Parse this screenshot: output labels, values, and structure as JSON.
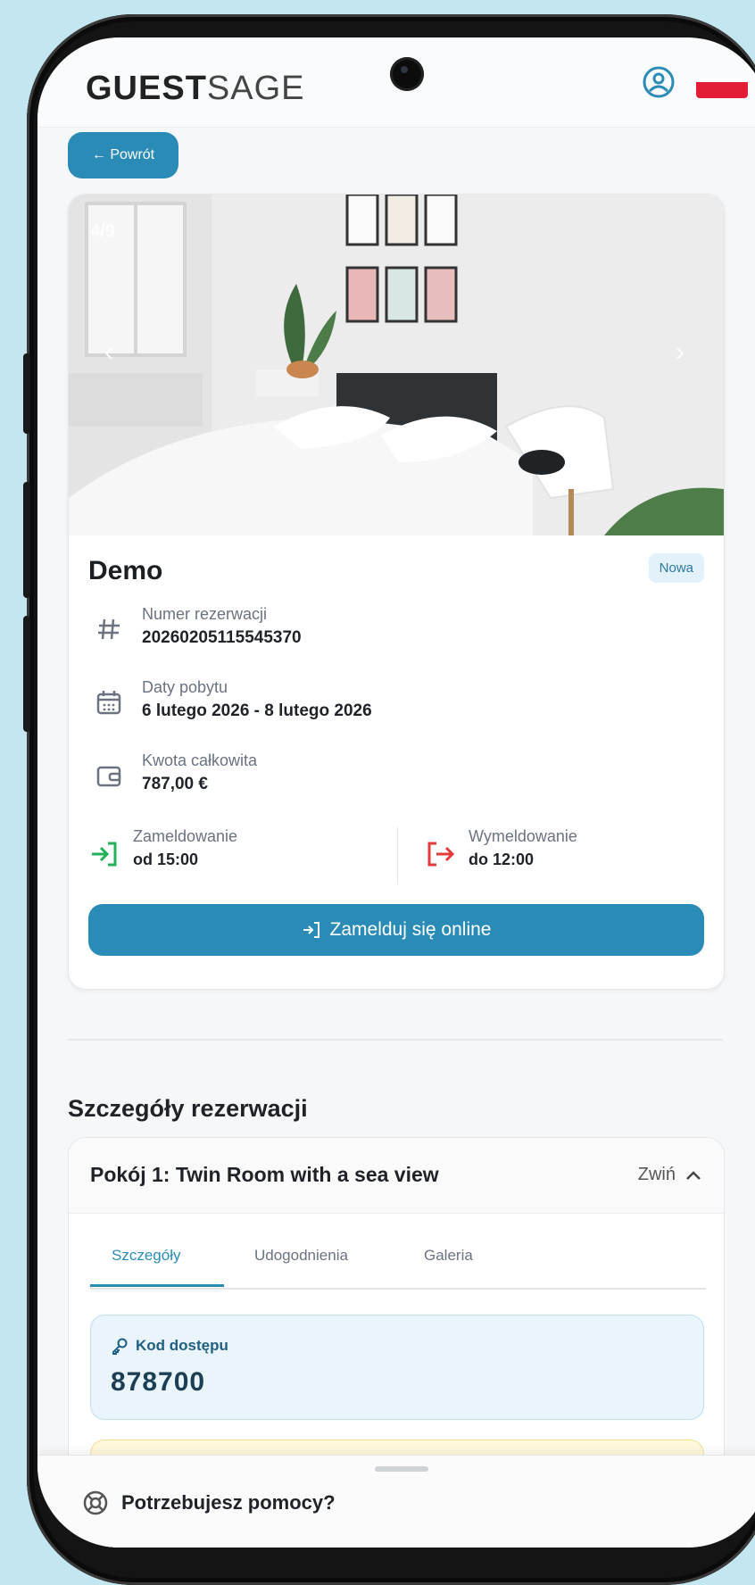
{
  "header": {
    "logo_bold": "GUEST",
    "logo_thin": "SAGE",
    "flag": "polish-flag"
  },
  "back_label": "← Powrót",
  "reservation": {
    "photo_counter": "4/9",
    "hotel_name": "Demo",
    "status": "Nowa",
    "number_label": "Numer rezerwacji",
    "number_value": "20260205115545370",
    "dates_label": "Daty pobytu",
    "dates_value": "6 lutego 2026 - 8 lutego 2026",
    "amount_label": "Kwota całkowita",
    "amount_value": "787,00 €",
    "checkin_label": "Zameldowanie",
    "checkin_value": "od 15:00",
    "checkout_label": "Wymeldowanie",
    "checkout_value": "do 12:00",
    "online_checkin_label": "Zamelduj się online"
  },
  "details": {
    "section_title": "Szczegóły rezerwacji",
    "room_title": "Pokój 1: Twin Room with a sea view",
    "collapse_label": "Zwiń",
    "tabs": [
      {
        "label": "Szczegóły",
        "active": true
      },
      {
        "label": "Udogodnienia",
        "active": false
      },
      {
        "label": "Galeria",
        "active": false
      }
    ],
    "access_label": "Kod dostępu",
    "access_code": "878700"
  },
  "help": {
    "label": "Potrzebujesz pomocy?"
  },
  "colors": {
    "accent": "#2a8cb6",
    "background": "#c3e6f1",
    "checkin_icon": "#22b05a",
    "checkout_icon": "#e23b3b"
  }
}
